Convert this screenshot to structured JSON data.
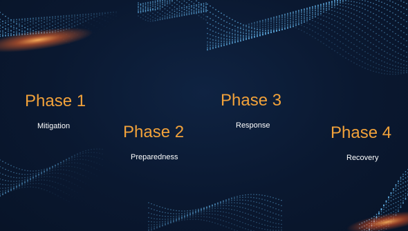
{
  "phases": [
    {
      "title": "Phase 1",
      "subtitle": "Mitigation"
    },
    {
      "title": "Phase 2",
      "subtitle": "Preparedness"
    },
    {
      "title": "Phase 3",
      "subtitle": "Response"
    },
    {
      "title": "Phase 4",
      "subtitle": "Recovery"
    }
  ],
  "colors": {
    "background": "#0a1830",
    "title": "#f2a23a",
    "subtitle": "#ffffff",
    "particles": "#6fc6ff",
    "glow": "#ff7a2e"
  }
}
